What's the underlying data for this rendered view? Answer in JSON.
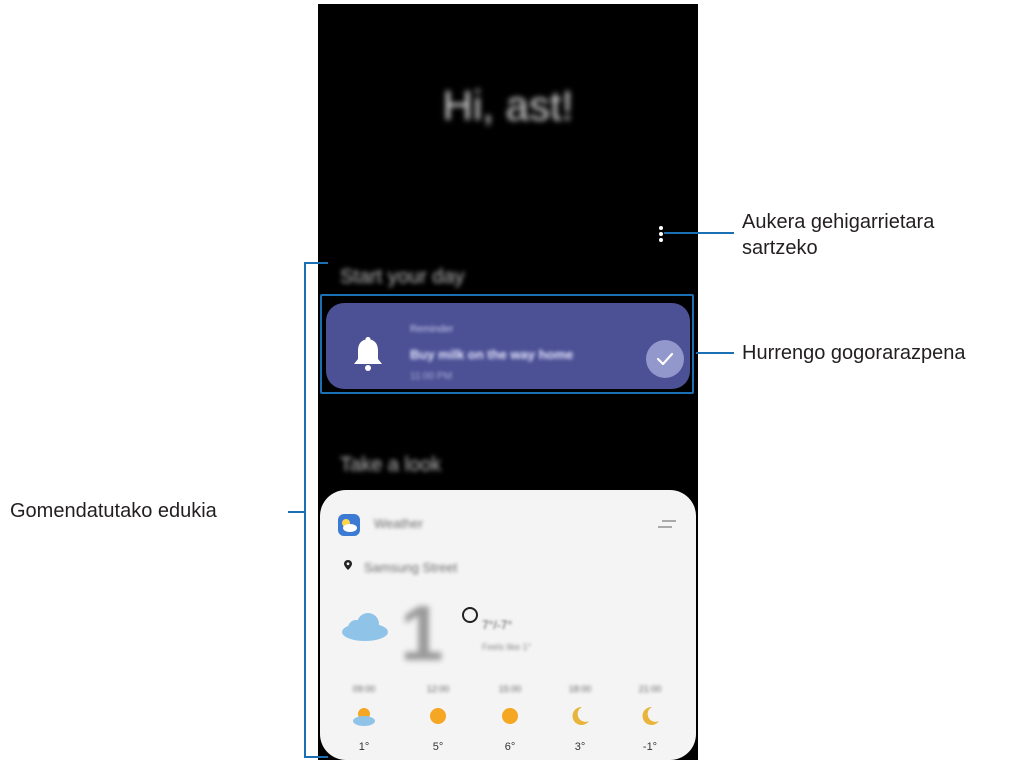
{
  "phone": {
    "greeting": "Hi, ast!",
    "section_start": "Start your day",
    "section_look": "Take a look",
    "reminder": {
      "header": "Reminder",
      "title": "Buy milk on the way home",
      "time": "11:00 PM"
    },
    "weather": {
      "app_name": "Weather",
      "location": "Samsung Street",
      "current_temp": "1",
      "hi_lo": "7°/-7°",
      "feels_like": "Feels like 1°",
      "hours": [
        {
          "time": "09:00",
          "icon": "partly-cloudy-sun-icon",
          "temp": "1°"
        },
        {
          "time": "12:00",
          "icon": "sun-icon",
          "temp": "5°"
        },
        {
          "time": "15:00",
          "icon": "sun-icon",
          "temp": "6°"
        },
        {
          "time": "18:00",
          "icon": "moon-icon",
          "temp": "3°"
        },
        {
          "time": "21:00",
          "icon": "moon-icon",
          "temp": "-1°"
        }
      ]
    }
  },
  "callouts": {
    "more_options_line1": "Aukera gehigarrietara",
    "more_options_line2": "sartzeko",
    "next_reminder": "Hurrengo gogorarazpena",
    "recommended": "Gomendatutako edukia"
  },
  "colors": {
    "reminder_card": "#4c5196",
    "callout_line": "#1b6fb4",
    "sun": "#f5a623",
    "moon": "#e8b43a",
    "cloud": "#8fc4e8"
  }
}
